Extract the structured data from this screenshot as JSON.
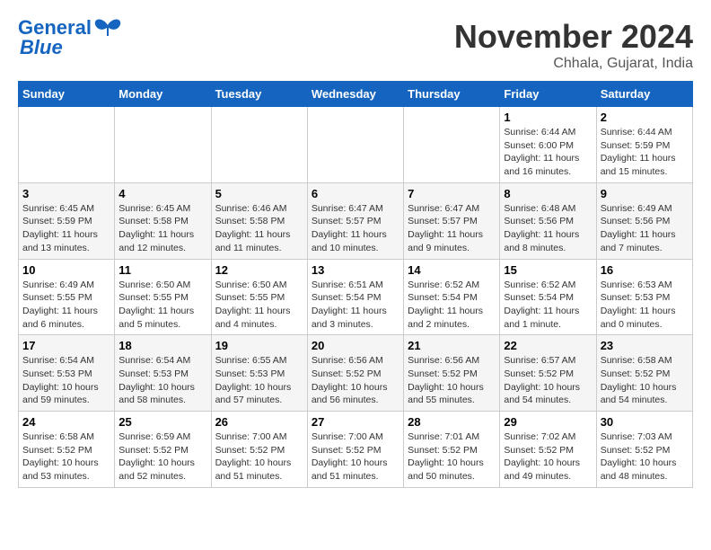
{
  "logo": {
    "line1": "General",
    "line2": "Blue"
  },
  "title": "November 2024",
  "subtitle": "Chhala, Gujarat, India",
  "weekdays": [
    "Sunday",
    "Monday",
    "Tuesday",
    "Wednesday",
    "Thursday",
    "Friday",
    "Saturday"
  ],
  "weeks": [
    [
      {
        "day": "",
        "info": ""
      },
      {
        "day": "",
        "info": ""
      },
      {
        "day": "",
        "info": ""
      },
      {
        "day": "",
        "info": ""
      },
      {
        "day": "",
        "info": ""
      },
      {
        "day": "1",
        "info": "Sunrise: 6:44 AM\nSunset: 6:00 PM\nDaylight: 11 hours and 16 minutes."
      },
      {
        "day": "2",
        "info": "Sunrise: 6:44 AM\nSunset: 5:59 PM\nDaylight: 11 hours and 15 minutes."
      }
    ],
    [
      {
        "day": "3",
        "info": "Sunrise: 6:45 AM\nSunset: 5:59 PM\nDaylight: 11 hours and 13 minutes."
      },
      {
        "day": "4",
        "info": "Sunrise: 6:45 AM\nSunset: 5:58 PM\nDaylight: 11 hours and 12 minutes."
      },
      {
        "day": "5",
        "info": "Sunrise: 6:46 AM\nSunset: 5:58 PM\nDaylight: 11 hours and 11 minutes."
      },
      {
        "day": "6",
        "info": "Sunrise: 6:47 AM\nSunset: 5:57 PM\nDaylight: 11 hours and 10 minutes."
      },
      {
        "day": "7",
        "info": "Sunrise: 6:47 AM\nSunset: 5:57 PM\nDaylight: 11 hours and 9 minutes."
      },
      {
        "day": "8",
        "info": "Sunrise: 6:48 AM\nSunset: 5:56 PM\nDaylight: 11 hours and 8 minutes."
      },
      {
        "day": "9",
        "info": "Sunrise: 6:49 AM\nSunset: 5:56 PM\nDaylight: 11 hours and 7 minutes."
      }
    ],
    [
      {
        "day": "10",
        "info": "Sunrise: 6:49 AM\nSunset: 5:55 PM\nDaylight: 11 hours and 6 minutes."
      },
      {
        "day": "11",
        "info": "Sunrise: 6:50 AM\nSunset: 5:55 PM\nDaylight: 11 hours and 5 minutes."
      },
      {
        "day": "12",
        "info": "Sunrise: 6:50 AM\nSunset: 5:55 PM\nDaylight: 11 hours and 4 minutes."
      },
      {
        "day": "13",
        "info": "Sunrise: 6:51 AM\nSunset: 5:54 PM\nDaylight: 11 hours and 3 minutes."
      },
      {
        "day": "14",
        "info": "Sunrise: 6:52 AM\nSunset: 5:54 PM\nDaylight: 11 hours and 2 minutes."
      },
      {
        "day": "15",
        "info": "Sunrise: 6:52 AM\nSunset: 5:54 PM\nDaylight: 11 hours and 1 minute."
      },
      {
        "day": "16",
        "info": "Sunrise: 6:53 AM\nSunset: 5:53 PM\nDaylight: 11 hours and 0 minutes."
      }
    ],
    [
      {
        "day": "17",
        "info": "Sunrise: 6:54 AM\nSunset: 5:53 PM\nDaylight: 10 hours and 59 minutes."
      },
      {
        "day": "18",
        "info": "Sunrise: 6:54 AM\nSunset: 5:53 PM\nDaylight: 10 hours and 58 minutes."
      },
      {
        "day": "19",
        "info": "Sunrise: 6:55 AM\nSunset: 5:53 PM\nDaylight: 10 hours and 57 minutes."
      },
      {
        "day": "20",
        "info": "Sunrise: 6:56 AM\nSunset: 5:52 PM\nDaylight: 10 hours and 56 minutes."
      },
      {
        "day": "21",
        "info": "Sunrise: 6:56 AM\nSunset: 5:52 PM\nDaylight: 10 hours and 55 minutes."
      },
      {
        "day": "22",
        "info": "Sunrise: 6:57 AM\nSunset: 5:52 PM\nDaylight: 10 hours and 54 minutes."
      },
      {
        "day": "23",
        "info": "Sunrise: 6:58 AM\nSunset: 5:52 PM\nDaylight: 10 hours and 54 minutes."
      }
    ],
    [
      {
        "day": "24",
        "info": "Sunrise: 6:58 AM\nSunset: 5:52 PM\nDaylight: 10 hours and 53 minutes."
      },
      {
        "day": "25",
        "info": "Sunrise: 6:59 AM\nSunset: 5:52 PM\nDaylight: 10 hours and 52 minutes."
      },
      {
        "day": "26",
        "info": "Sunrise: 7:00 AM\nSunset: 5:52 PM\nDaylight: 10 hours and 51 minutes."
      },
      {
        "day": "27",
        "info": "Sunrise: 7:00 AM\nSunset: 5:52 PM\nDaylight: 10 hours and 51 minutes."
      },
      {
        "day": "28",
        "info": "Sunrise: 7:01 AM\nSunset: 5:52 PM\nDaylight: 10 hours and 50 minutes."
      },
      {
        "day": "29",
        "info": "Sunrise: 7:02 AM\nSunset: 5:52 PM\nDaylight: 10 hours and 49 minutes."
      },
      {
        "day": "30",
        "info": "Sunrise: 7:03 AM\nSunset: 5:52 PM\nDaylight: 10 hours and 48 minutes."
      }
    ]
  ]
}
